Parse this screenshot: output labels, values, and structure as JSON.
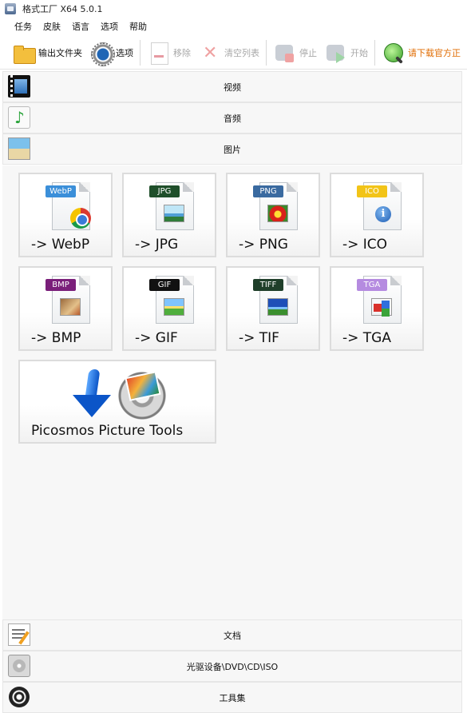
{
  "window": {
    "title": "格式工厂 X64 5.0.1"
  },
  "menubar": {
    "items": [
      "任务",
      "皮肤",
      "语言",
      "选项",
      "帮助"
    ]
  },
  "toolbar": {
    "output_folder": "输出文件夹",
    "options": "选项",
    "remove": "移除",
    "clear_list": "清空列表",
    "stop": "停止",
    "start": "开始",
    "download": "请下载官方正"
  },
  "categories": {
    "video": "视频",
    "audio": "音频",
    "image": "图片",
    "document": "文档",
    "optical": "光驱设备\\DVD\\CD\\ISO",
    "tools": "工具集"
  },
  "tiles": [
    {
      "tag": "WebP",
      "label": "-> WebP",
      "tag_color": "#3b8fd9"
    },
    {
      "tag": "JPG",
      "label": "-> JPG",
      "tag_color": "#1f4f2a"
    },
    {
      "tag": "PNG",
      "label": "-> PNG",
      "tag_color": "#3a6aa0"
    },
    {
      "tag": "ICO",
      "label": "-> ICO",
      "tag_color": "#f2c418"
    },
    {
      "tag": "BMP",
      "label": "-> BMP",
      "tag_color": "#7a1f7a"
    },
    {
      "tag": "GIF",
      "label": "-> GIF",
      "tag_color": "#111111"
    },
    {
      "tag": "TIFF",
      "label": "-> TIF",
      "tag_color": "#1f3f2a"
    },
    {
      "tag": "TGA",
      "label": "-> TGA",
      "tag_color": "#b58be0"
    }
  ],
  "picosmos": {
    "label": "Picosmos Picture Tools"
  }
}
